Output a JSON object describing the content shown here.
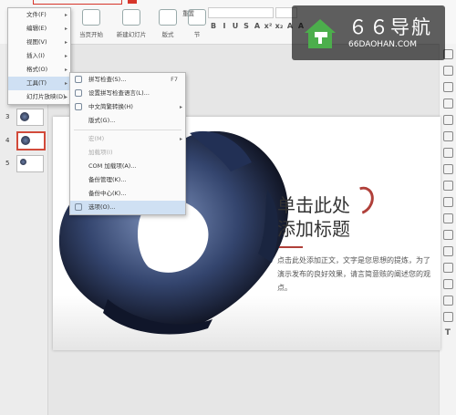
{
  "ribbon": {
    "start_label": "当页开始",
    "newslide_label": "新建幻灯片",
    "layout_label": "版式",
    "section_label": "节",
    "reset_label": "重置",
    "format_buttons": [
      "B",
      "I",
      "U",
      "S",
      "A",
      "x²",
      "x₂",
      "A",
      "A"
    ]
  },
  "menu": {
    "items": [
      {
        "label": "文件(F)",
        "arrow": "▸"
      },
      {
        "label": "编辑(E)",
        "arrow": "▸"
      },
      {
        "label": "视图(V)",
        "arrow": "▸"
      },
      {
        "label": "插入(I)",
        "arrow": "▸"
      },
      {
        "label": "格式(O)",
        "arrow": "▸"
      },
      {
        "label": "工具(T)",
        "arrow": "▸"
      },
      {
        "label": "幻灯片放映(D)",
        "arrow": "▸"
      }
    ]
  },
  "tools_submenu": {
    "items": [
      {
        "label": "拼写检查(S)...",
        "shortcut": "F7"
      },
      {
        "label": "设置拼写检查语言(L)...",
        "shortcut": ""
      },
      {
        "label": "中文简繁转换(H)",
        "arrow": "▸"
      },
      {
        "label": "宏(M)",
        "arrow": "▸"
      },
      {
        "label": "加载项(I)"
      },
      {
        "label": "COM 加载项(A)..."
      },
      {
        "label": "备份管理(K)..."
      },
      {
        "label": "备份中心(K)..."
      },
      {
        "label": "选项(O)..."
      }
    ],
    "extra": "版式(G)..."
  },
  "slides": {
    "numbers": [
      "3",
      "4",
      "5"
    ]
  },
  "slide": {
    "title_line1": "单击此处",
    "title_line2": "添加标题",
    "body": "点击此处添加正文，文字是您思想的提炼，为了演示发布的良好效果，请言简意赅的阐述您的观点。"
  },
  "watermark": {
    "big": "６６导航",
    "small": "66DAOHAN.COM"
  },
  "colors": {
    "accent": "#b0403a",
    "highlight": "#cfe0f3"
  }
}
